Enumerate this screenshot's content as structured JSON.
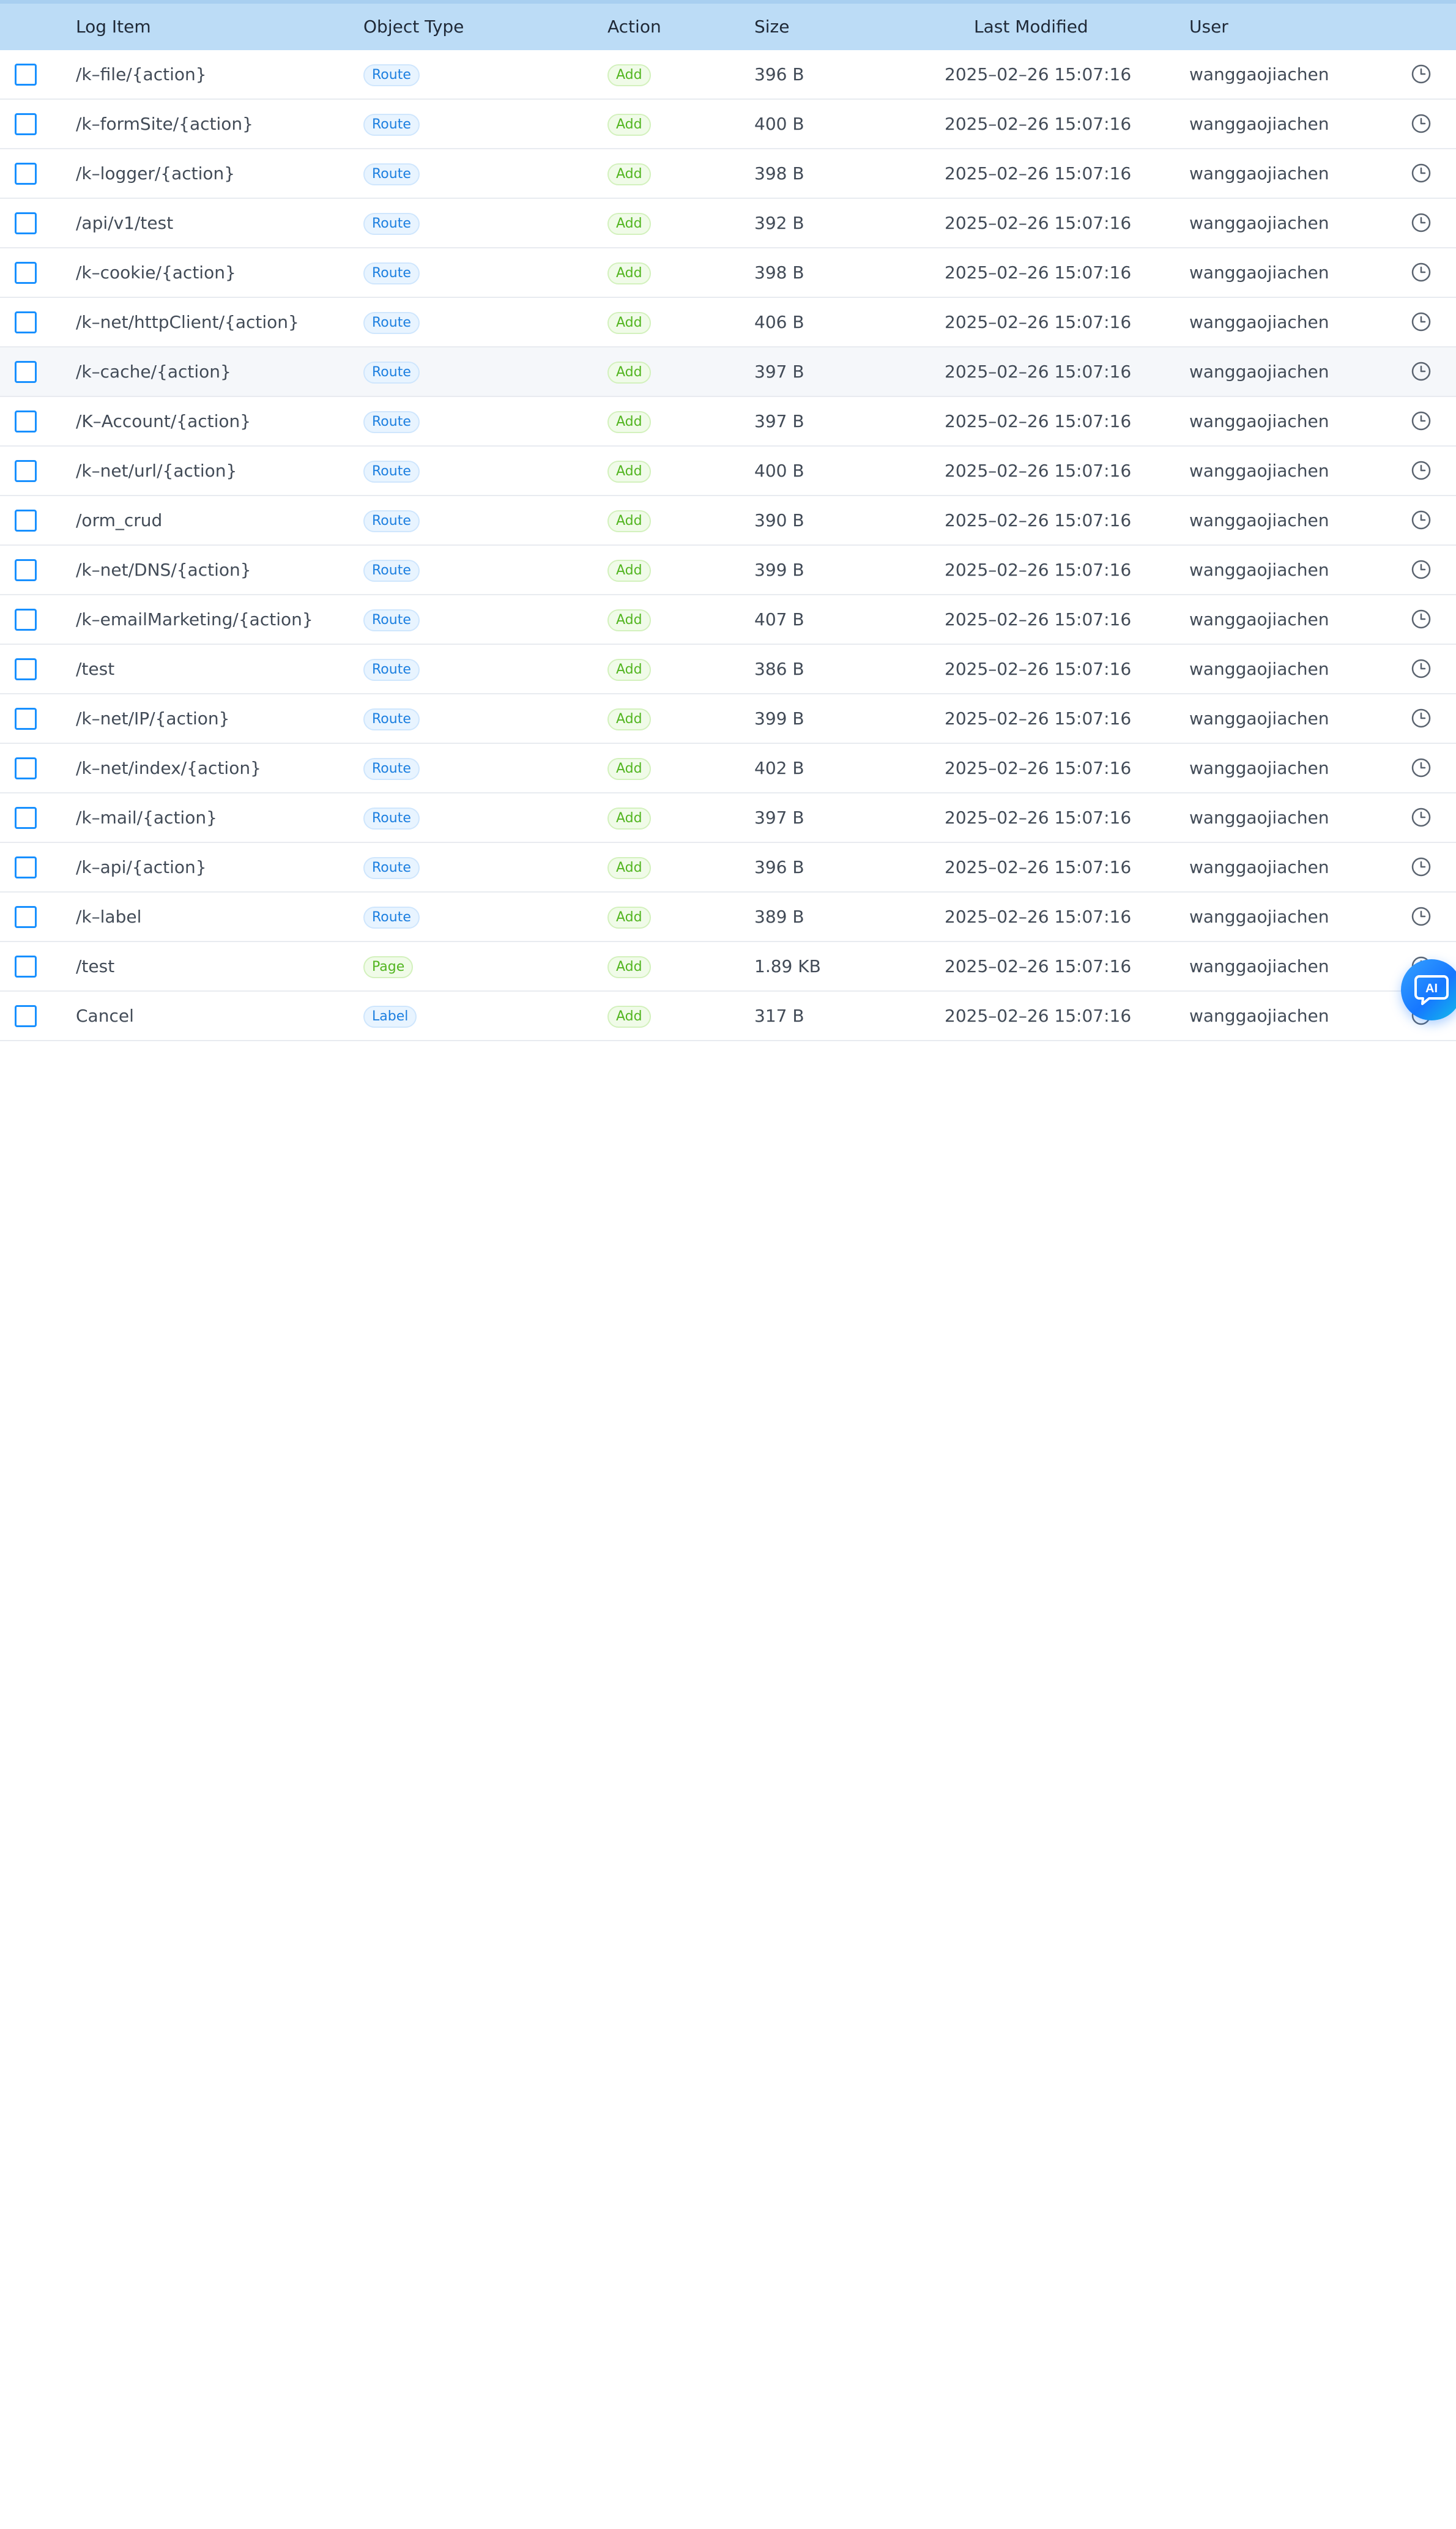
{
  "table": {
    "headers": {
      "log_item": "Log Item",
      "object_type": "Object Type",
      "action": "Action",
      "size": "Size",
      "last_modified": "Last Modified",
      "user": "User"
    },
    "rows": [
      {
        "item": "/k–file/{action}",
        "type": "Route",
        "type_style": "route",
        "action": "Add",
        "size": "396 B",
        "modified": "2025–02–26 15:07:16",
        "user": "wanggaojiachen"
      },
      {
        "item": "/k–formSite/{action}",
        "type": "Route",
        "type_style": "route",
        "action": "Add",
        "size": "400 B",
        "modified": "2025–02–26 15:07:16",
        "user": "wanggaojiachen"
      },
      {
        "item": "/k–logger/{action}",
        "type": "Route",
        "type_style": "route",
        "action": "Add",
        "size": "398 B",
        "modified": "2025–02–26 15:07:16",
        "user": "wanggaojiachen"
      },
      {
        "item": "/api/v1/test",
        "type": "Route",
        "type_style": "route",
        "action": "Add",
        "size": "392 B",
        "modified": "2025–02–26 15:07:16",
        "user": "wanggaojiachen"
      },
      {
        "item": "/k–cookie/{action}",
        "type": "Route",
        "type_style": "route",
        "action": "Add",
        "size": "398 B",
        "modified": "2025–02–26 15:07:16",
        "user": "wanggaojiachen"
      },
      {
        "item": "/k–net/httpClient/{action}",
        "type": "Route",
        "type_style": "route",
        "action": "Add",
        "size": "406 B",
        "modified": "2025–02–26 15:07:16",
        "user": "wanggaojiachen"
      },
      {
        "item": "/k–cache/{action}",
        "type": "Route",
        "type_style": "route",
        "action": "Add",
        "size": "397 B",
        "modified": "2025–02–26 15:07:16",
        "user": "wanggaojiachen"
      },
      {
        "item": "/K–Account/{action}",
        "type": "Route",
        "type_style": "route",
        "action": "Add",
        "size": "397 B",
        "modified": "2025–02–26 15:07:16",
        "user": "wanggaojiachen"
      },
      {
        "item": "/k–net/url/{action}",
        "type": "Route",
        "type_style": "route",
        "action": "Add",
        "size": "400 B",
        "modified": "2025–02–26 15:07:16",
        "user": "wanggaojiachen"
      },
      {
        "item": "/orm_crud",
        "type": "Route",
        "type_style": "route",
        "action": "Add",
        "size": "390 B",
        "modified": "2025–02–26 15:07:16",
        "user": "wanggaojiachen"
      },
      {
        "item": "/k–net/DNS/{action}",
        "type": "Route",
        "type_style": "route",
        "action": "Add",
        "size": "399 B",
        "modified": "2025–02–26 15:07:16",
        "user": "wanggaojiachen"
      },
      {
        "item": "/k–emailMarketing/{action}",
        "type": "Route",
        "type_style": "route",
        "action": "Add",
        "size": "407 B",
        "modified": "2025–02–26 15:07:16",
        "user": "wanggaojiachen"
      },
      {
        "item": "/test",
        "type": "Route",
        "type_style": "route",
        "action": "Add",
        "size": "386 B",
        "modified": "2025–02–26 15:07:16",
        "user": "wanggaojiachen"
      },
      {
        "item": "/k–net/IP/{action}",
        "type": "Route",
        "type_style": "route",
        "action": "Add",
        "size": "399 B",
        "modified": "2025–02–26 15:07:16",
        "user": "wanggaojiachen"
      },
      {
        "item": "/k–net/index/{action}",
        "type": "Route",
        "type_style": "route",
        "action": "Add",
        "size": "402 B",
        "modified": "2025–02–26 15:07:16",
        "user": "wanggaojiachen"
      },
      {
        "item": "/k–mail/{action}",
        "type": "Route",
        "type_style": "route",
        "action": "Add",
        "size": "397 B",
        "modified": "2025–02–26 15:07:16",
        "user": "wanggaojiachen"
      },
      {
        "item": "/k–api/{action}",
        "type": "Route",
        "type_style": "route",
        "action": "Add",
        "size": "396 B",
        "modified": "2025–02–26 15:07:16",
        "user": "wanggaojiachen"
      },
      {
        "item": "/k–label",
        "type": "Route",
        "type_style": "route",
        "action": "Add",
        "size": "389 B",
        "modified": "2025–02–26 15:07:16",
        "user": "wanggaojiachen"
      },
      {
        "item": "/test",
        "type": "Page",
        "type_style": "page",
        "action": "Add",
        "size": "1.89 KB",
        "modified": "2025–02–26 15:07:16",
        "user": "wanggaojiachen"
      },
      {
        "item": "Cancel",
        "type": "Label",
        "type_style": "label",
        "action": "Add",
        "size": "317 B",
        "modified": "2025–02–26 15:07:16",
        "user": "wanggaojiachen"
      }
    ]
  },
  "ai_assistant": {
    "label": "AI",
    "icon": "chat-bubble-icon"
  },
  "colors": {
    "header_bg": "#bcdcf6",
    "checkbox_border": "#1890ff",
    "route_tag": "#1c7fe0",
    "add_tag": "#52b520",
    "ai_button": "#1677ff"
  },
  "hovered_row_index": 6
}
